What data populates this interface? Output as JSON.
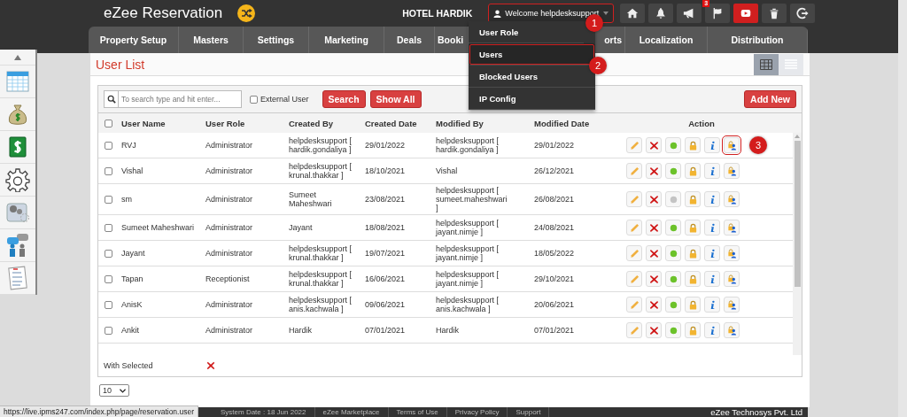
{
  "header": {
    "app_name": "eZee Reservation",
    "hotel_name": "HOTEL HARDIK",
    "welcome": {
      "label": "Welcome helpdesksupport",
      "annotation": "1"
    },
    "toolbar": [
      {
        "kind": "home"
      },
      {
        "kind": "bell"
      },
      {
        "kind": "megaphone"
      },
      {
        "kind": "flag",
        "badge": "3"
      },
      {
        "kind": "video"
      },
      {
        "kind": "trash"
      },
      {
        "kind": "logout"
      }
    ]
  },
  "user_menu": [
    {
      "label": "User Role",
      "selected": false
    },
    {
      "label": "Users",
      "selected": true,
      "annotation": "2"
    },
    {
      "label": "Blocked Users",
      "selected": false
    },
    {
      "label": "IP Config",
      "selected": false
    }
  ],
  "nav": [
    "Property Setup",
    "Masters",
    "Settings",
    "Marketing",
    "Deals",
    "Booki",
    "orts",
    "Localization",
    "Distribution"
  ],
  "sidebar": [
    {
      "kind": "up"
    },
    {
      "kind": "calendar"
    },
    {
      "kind": "moneybag"
    },
    {
      "kind": "dollar"
    },
    {
      "kind": "gear"
    },
    {
      "kind": "widget"
    },
    {
      "kind": "people"
    },
    {
      "kind": "checklist"
    }
  ],
  "page_title": "User List",
  "view_toggle": [
    {
      "kind": "grid",
      "selected": true
    },
    {
      "kind": "list",
      "selected": false
    }
  ],
  "search": {
    "placeholder": "To search type and hit enter...",
    "external_user_label": "External User",
    "external_user_checked": false,
    "search_button": "Search",
    "show_all_button": "Show All",
    "add_button": "Add New"
  },
  "table": {
    "select_all_checked": false,
    "columns": [
      "User Name",
      "User Role",
      "Created By",
      "Created Date",
      "Modified By",
      "Modified Date",
      "Action"
    ],
    "rows": [
      {
        "name": "RVJ",
        "role": "Administrator",
        "created_by": "helpdesksupport [ hardik.gondaliya ]",
        "created_date": "29/01/2022",
        "modified_by": "helpdesksupport [ hardik.gondaliya ]",
        "modified_date": "29/01/2022",
        "active": true,
        "checked": false,
        "annotation": "3"
      },
      {
        "name": "Vishal",
        "role": "Administrator",
        "created_by": "helpdesksupport [ krunal.thakkar ]",
        "created_date": "18/10/2021",
        "modified_by": "Vishal",
        "modified_date": "26/12/2021",
        "active": true,
        "checked": false
      },
      {
        "name": "sm",
        "role": "Administrator",
        "created_by": "Sumeet Maheshwari",
        "created_date": "23/08/2021",
        "modified_by": "helpdesksupport [ sumeet.maheshwari ]",
        "modified_date": "26/08/2021",
        "active": false,
        "checked": false
      },
      {
        "name": "Sumeet Maheshwari",
        "role": "Administrator",
        "created_by": "Jayant",
        "created_date": "18/08/2021",
        "modified_by": "helpdesksupport [ jayant.nimje ]",
        "modified_date": "24/08/2021",
        "active": true,
        "checked": false
      },
      {
        "name": "Jayant",
        "role": "Administrator",
        "created_by": "helpdesksupport [ krunal.thakkar ]",
        "created_date": "19/07/2021",
        "modified_by": "helpdesksupport [ jayant.nimje ]",
        "modified_date": "18/05/2022",
        "active": true,
        "checked": false
      },
      {
        "name": "Tapan",
        "role": "Receptionist",
        "created_by": "helpdesksupport [ krunal.thakkar ]",
        "created_date": "16/06/2021",
        "modified_by": "helpdesksupport [ jayant.nimje ]",
        "modified_date": "29/10/2021",
        "active": true,
        "checked": false
      },
      {
        "name": "AnisK",
        "role": "Administrator",
        "created_by": "helpdesksupport [ anis.kachwala ]",
        "created_date": "09/06/2021",
        "modified_by": "helpdesksupport [ anis.kachwala ]",
        "modified_date": "20/06/2021",
        "active": true,
        "checked": false
      },
      {
        "name": "Ankit",
        "role": "Administrator",
        "created_by": "Hardik",
        "created_date": "07/01/2021",
        "modified_by": "Hardik",
        "modified_date": "07/01/2021",
        "active": true,
        "checked": false
      }
    ]
  },
  "with_selected": "With Selected",
  "page_size": "10",
  "footer": [
    "System Date : 18 Jun 2022",
    "eZee Marketplace",
    "Terms of Use",
    "Privacy Policy",
    "Support"
  ],
  "company": "eZee Technosys Pvt. Ltd",
  "status_url": "https://live.ipms247.com/index.php/page/reservation.user"
}
